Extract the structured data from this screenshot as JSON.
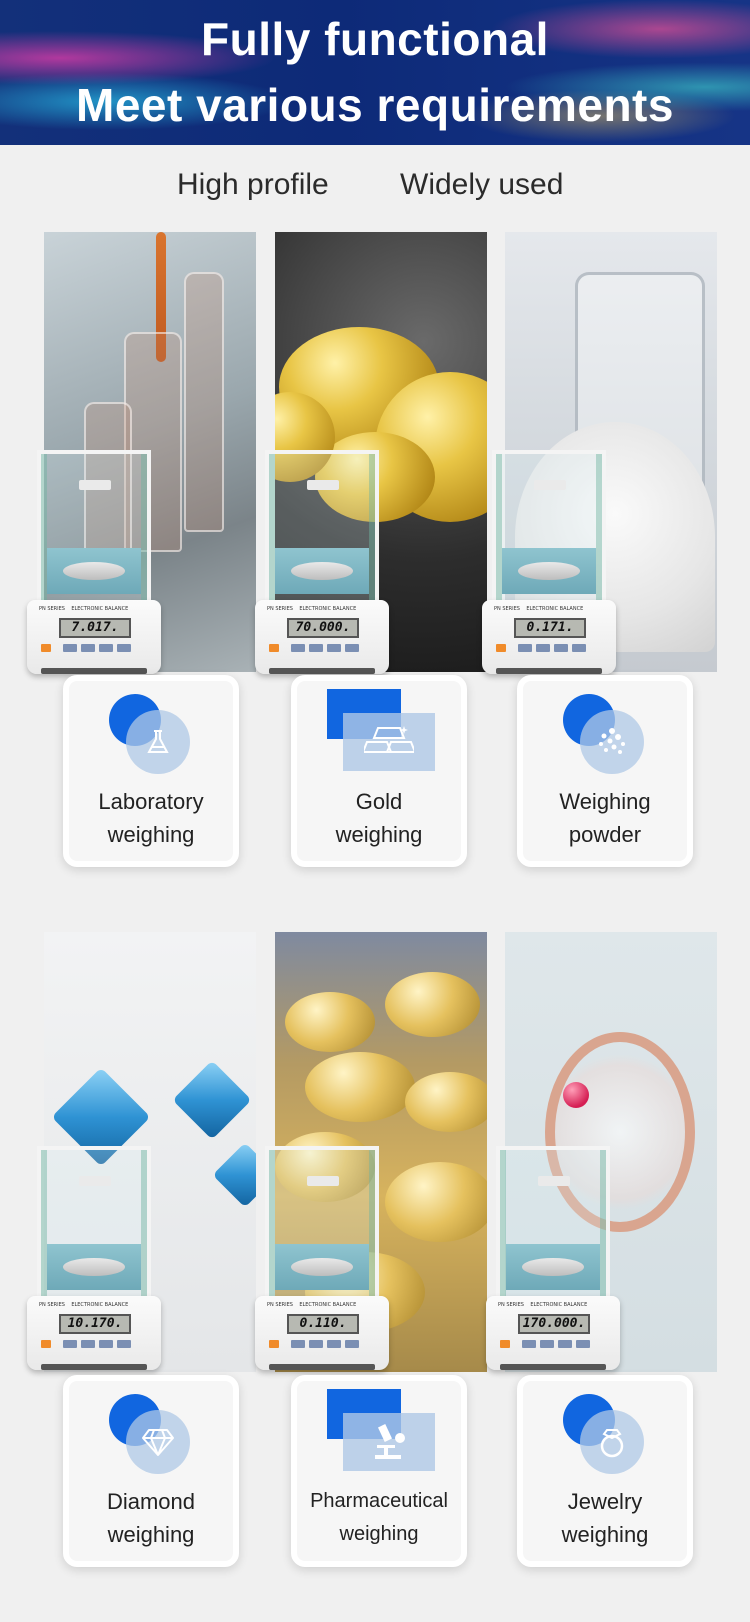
{
  "banner": {
    "line1": "Fully functional",
    "line2": "Meet various requirements"
  },
  "subheadings": [
    "High profile",
    "Widely used"
  ],
  "applications": [
    {
      "line1": "Laboratory",
      "line2": "weighing",
      "display": "7.017.",
      "icon": "flask-icon"
    },
    {
      "line1": "Gold",
      "line2": "weighing",
      "display": "70.000.",
      "icon": "gold-bars-icon"
    },
    {
      "line1": "Weighing",
      "line2": "powder",
      "display": "0.171.",
      "icon": "powder-icon"
    },
    {
      "line1": "Diamond",
      "line2": "weighing",
      "display": "10.170.",
      "icon": "diamond-icon"
    },
    {
      "line1": "Pharmaceutical",
      "line2": "weighing",
      "display": "0.110.",
      "icon": "microscope-icon"
    },
    {
      "line1": "Jewelry",
      "line2": "weighing",
      "display": "170.000.",
      "icon": "ring-icon"
    }
  ],
  "colors": {
    "accent": "#1166e0",
    "banner": "#0d2a78",
    "icon_tint": "#afc8e6"
  }
}
